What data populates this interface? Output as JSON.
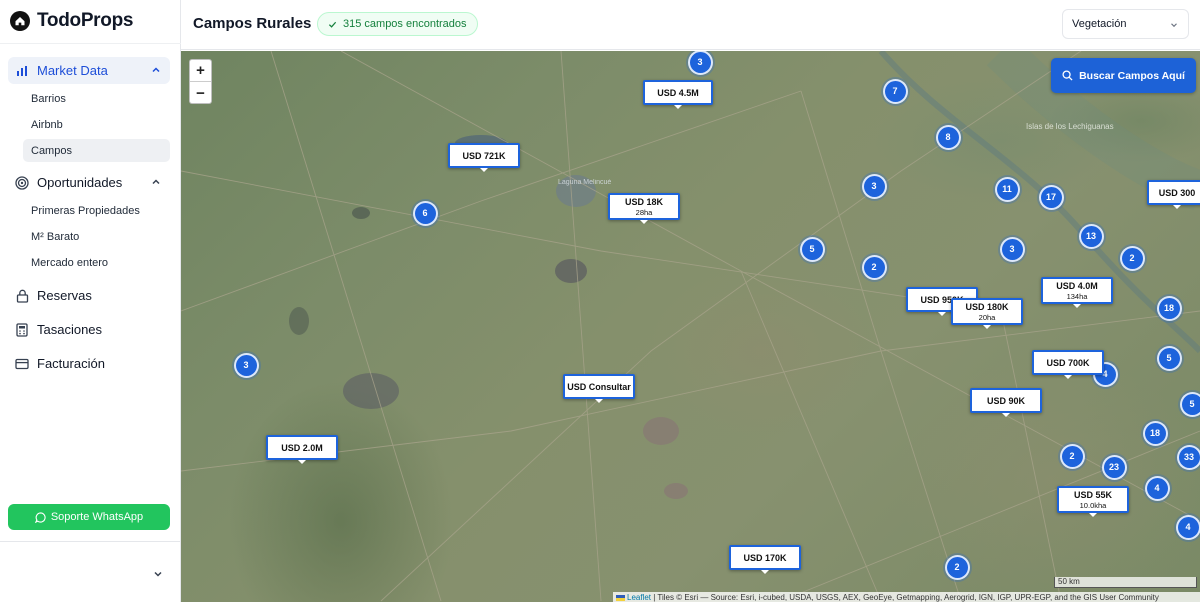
{
  "app": {
    "name": "TodoProps"
  },
  "sidebar": {
    "groups": [
      {
        "label": "Market Data",
        "icon": "bar-chart-icon",
        "expanded": true,
        "items": [
          {
            "label": "Barrios"
          },
          {
            "label": "Airbnb"
          },
          {
            "label": "Campos",
            "active": true
          }
        ]
      },
      {
        "label": "Oportunidades",
        "icon": "target-icon",
        "expanded": true,
        "items": [
          {
            "label": "Primeras Propiedades"
          },
          {
            "label": "M² Barato"
          },
          {
            "label": "Mercado entero"
          }
        ]
      },
      {
        "label": "Reservas",
        "icon": "lock-icon"
      },
      {
        "label": "Tasaciones",
        "icon": "calculator-icon"
      },
      {
        "label": "Facturación",
        "icon": "credit-card-icon"
      }
    ],
    "support_label": "Soporte WhatsApp"
  },
  "header": {
    "title": "Campos Rurales",
    "badge": "315 campos encontrados",
    "layer_select": {
      "value": "Vegetación"
    }
  },
  "map": {
    "zoom_in": "+",
    "zoom_out": "−",
    "search_label": "Buscar Campos Aquí",
    "scale_label": "50 km",
    "attribution_link": "Leaflet",
    "attribution_text": " | Tiles © Esri — Source: Esri, i-cubed, USDA, USGS, AEX, GeoEye, Getmapping, Aerogrid, IGN, IGP, UPR-EGP, and the GIS User Community",
    "place_labels": [
      "Islas de los Lechiguanas",
      "Laguna Melincué"
    ],
    "clusters": [
      "3",
      "7",
      "8",
      "3",
      "11",
      "17",
      "13",
      "6",
      "5",
      "2",
      "3",
      "2",
      "18",
      "3",
      "5",
      "4",
      "5",
      "18",
      "2",
      "23",
      "33",
      "4",
      "4",
      "2"
    ],
    "prices": [
      {
        "label": "USD 4.5M"
      },
      {
        "label": "USD 721K"
      },
      {
        "label": "USD 18K",
        "area": "28ha"
      },
      {
        "label": "USD 300"
      },
      {
        "label": "USD 4.0M",
        "area": "134ha"
      },
      {
        "label": "USD 950K"
      },
      {
        "label": "USD 180K",
        "area": "20ha"
      },
      {
        "label": "USD 700K"
      },
      {
        "label": "USD Consultar"
      },
      {
        "label": "USD 90K"
      },
      {
        "label": "USD 2.0M"
      },
      {
        "label": "USD 55K",
        "area": "10.0kha"
      },
      {
        "label": "USD 170K"
      }
    ]
  },
  "colors": {
    "accent": "#1d63dc",
    "success": "#22c55e",
    "active_nav": "#1d4ed8"
  }
}
